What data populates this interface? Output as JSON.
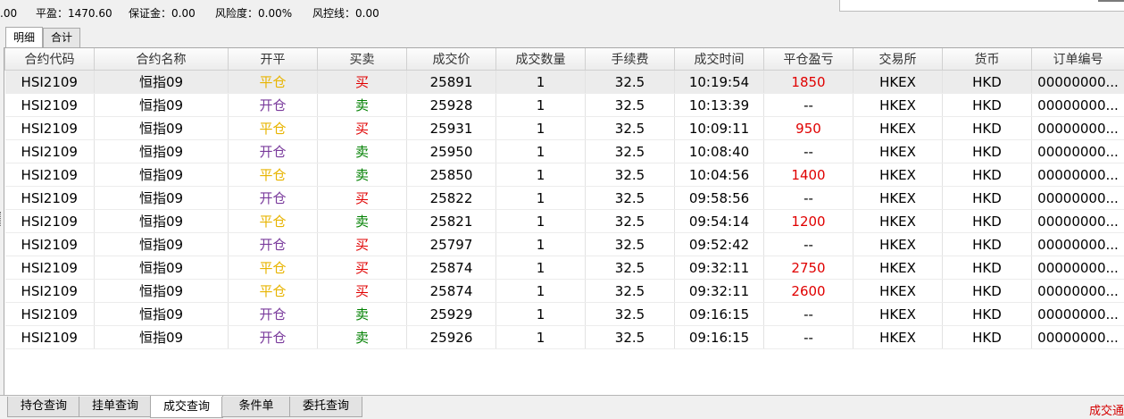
{
  "status_bar": {
    "balance_cut": ".00",
    "closed_pnl": "平盈：1470.60",
    "margin": "保证金：0.00",
    "risk": "风险度：0.00%",
    "risk_line": "风控线：0.00"
  },
  "top_tabs": [
    {
      "label": "明细",
      "active": true
    },
    {
      "label": "合计",
      "active": false
    }
  ],
  "columns": [
    "合约代码",
    "合约名称",
    "开平",
    "买卖",
    "成交价",
    "成交数量",
    "手续费",
    "成交时间",
    "平仓盈亏",
    "交易所",
    "货币",
    "订单编号"
  ],
  "colors": {
    "open_close_flat": "#e8b400",
    "open_close_open": "#7a3b9c",
    "buy": "#e00000",
    "sell": "#008000",
    "pnl": "#e00000"
  },
  "rows": [
    {
      "code": "HSI2109",
      "name": "恒指09",
      "oc": "平仓",
      "side": "买",
      "price": "25891",
      "qty": "1",
      "fee": "32.5",
      "time": "10:19:54",
      "pnl": "1850",
      "exchange": "HKEX",
      "currency": "HKD",
      "order": "00000000..."
    },
    {
      "code": "HSI2109",
      "name": "恒指09",
      "oc": "开仓",
      "side": "卖",
      "price": "25928",
      "qty": "1",
      "fee": "32.5",
      "time": "10:13:39",
      "pnl": "--",
      "exchange": "HKEX",
      "currency": "HKD",
      "order": "00000000..."
    },
    {
      "code": "HSI2109",
      "name": "恒指09",
      "oc": "平仓",
      "side": "买",
      "price": "25931",
      "qty": "1",
      "fee": "32.5",
      "time": "10:09:11",
      "pnl": "950",
      "exchange": "HKEX",
      "currency": "HKD",
      "order": "00000000..."
    },
    {
      "code": "HSI2109",
      "name": "恒指09",
      "oc": "开仓",
      "side": "卖",
      "price": "25950",
      "qty": "1",
      "fee": "32.5",
      "time": "10:08:40",
      "pnl": "--",
      "exchange": "HKEX",
      "currency": "HKD",
      "order": "00000000..."
    },
    {
      "code": "HSI2109",
      "name": "恒指09",
      "oc": "平仓",
      "side": "卖",
      "price": "25850",
      "qty": "1",
      "fee": "32.5",
      "time": "10:04:56",
      "pnl": "1400",
      "exchange": "HKEX",
      "currency": "HKD",
      "order": "00000000..."
    },
    {
      "code": "HSI2109",
      "name": "恒指09",
      "oc": "开仓",
      "side": "买",
      "price": "25822",
      "qty": "1",
      "fee": "32.5",
      "time": "09:58:56",
      "pnl": "--",
      "exchange": "HKEX",
      "currency": "HKD",
      "order": "00000000..."
    },
    {
      "code": "HSI2109",
      "name": "恒指09",
      "oc": "平仓",
      "side": "卖",
      "price": "25821",
      "qty": "1",
      "fee": "32.5",
      "time": "09:54:14",
      "pnl": "1200",
      "exchange": "HKEX",
      "currency": "HKD",
      "order": "00000000..."
    },
    {
      "code": "HSI2109",
      "name": "恒指09",
      "oc": "开仓",
      "side": "买",
      "price": "25797",
      "qty": "1",
      "fee": "32.5",
      "time": "09:52:42",
      "pnl": "--",
      "exchange": "HKEX",
      "currency": "HKD",
      "order": "00000000..."
    },
    {
      "code": "HSI2109",
      "name": "恒指09",
      "oc": "平仓",
      "side": "买",
      "price": "25874",
      "qty": "1",
      "fee": "32.5",
      "time": "09:32:11",
      "pnl": "2750",
      "exchange": "HKEX",
      "currency": "HKD",
      "order": "00000000..."
    },
    {
      "code": "HSI2109",
      "name": "恒指09",
      "oc": "平仓",
      "side": "买",
      "price": "25874",
      "qty": "1",
      "fee": "32.5",
      "time": "09:32:11",
      "pnl": "2600",
      "exchange": "HKEX",
      "currency": "HKD",
      "order": "00000000..."
    },
    {
      "code": "HSI2109",
      "name": "恒指09",
      "oc": "开仓",
      "side": "卖",
      "price": "25929",
      "qty": "1",
      "fee": "32.5",
      "time": "09:16:15",
      "pnl": "--",
      "exchange": "HKEX",
      "currency": "HKD",
      "order": "00000000..."
    },
    {
      "code": "HSI2109",
      "name": "恒指09",
      "oc": "开仓",
      "side": "卖",
      "price": "25926",
      "qty": "1",
      "fee": "32.5",
      "time": "09:16:15",
      "pnl": "--",
      "exchange": "HKEX",
      "currency": "HKD",
      "order": "00000000..."
    }
  ],
  "bottom_tabs": [
    {
      "label": "持仓查询",
      "active": false
    },
    {
      "label": "挂单查询",
      "active": false
    },
    {
      "label": "成交查询",
      "active": true
    },
    {
      "label": "条件单",
      "active": false
    },
    {
      "label": "委托查询",
      "active": false
    }
  ],
  "bottom_status": "成交通"
}
